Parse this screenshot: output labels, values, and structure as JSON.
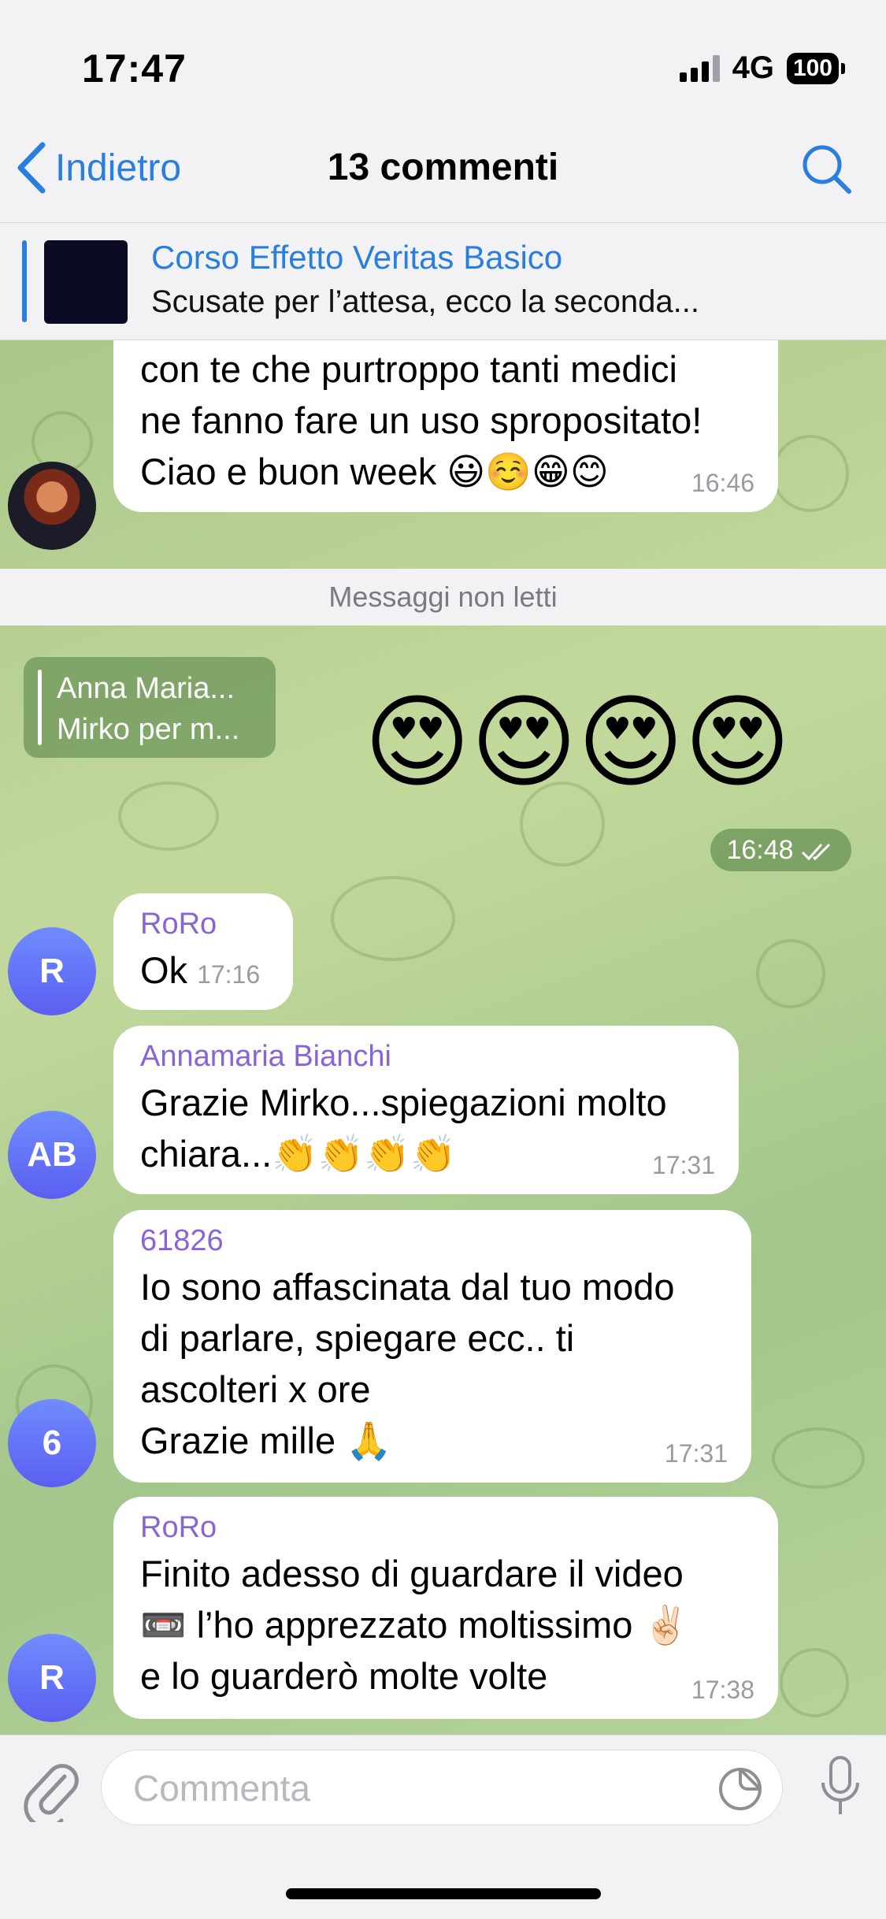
{
  "status": {
    "time": "17:47",
    "network": "4G",
    "battery": "100"
  },
  "nav": {
    "back_label": "Indietro",
    "title": "13 commenti"
  },
  "pinned": {
    "title": "Corso Effetto Veritas Basico",
    "text": "Scusate per l’attesa, ecco la seconda..."
  },
  "messages": {
    "m0": {
      "lines": [
        "con te che purtroppo tanti medici",
        "ne fanno fare un uso spropositato!",
        "Ciao e buon week 😃☺️😁😊"
      ],
      "time": "16:46"
    },
    "unread_label": "Messaggi non letti",
    "own": {
      "reply_name": "Anna Maria...",
      "reply_text": "Mirko per m...",
      "emojis": "😍😍😍😍",
      "time": "16:48"
    },
    "m1": {
      "avatar": "R",
      "name": "RoRo",
      "text": "Ok",
      "time": "17:16"
    },
    "m2": {
      "avatar": "AB",
      "name": "Annamaria Bianchi",
      "lines": [
        "Grazie Mirko...spiegazioni molto",
        "chiara...👏👏👏👏"
      ],
      "time": "17:31"
    },
    "m3": {
      "avatar": "6",
      "name": "61826",
      "lines": [
        "Io sono affascinata dal tuo modo",
        "di parlare, spiegare ecc.. ti",
        "ascolteri x ore",
        "Grazie mille 🙏"
      ],
      "time": "17:31"
    },
    "m4": {
      "avatar": "R",
      "name": "RoRo",
      "lines": [
        "Finito adesso di guardare il video",
        "📼 l’ho apprezzato moltissimo ✌🏻",
        "e lo guarderò molte volte"
      ],
      "time": "17:38"
    }
  },
  "input": {
    "placeholder": "Commenta"
  },
  "colors": {
    "accent": "#2a7ee0",
    "sender_name": "#8a64d6",
    "avatar": "#6b7cff"
  }
}
